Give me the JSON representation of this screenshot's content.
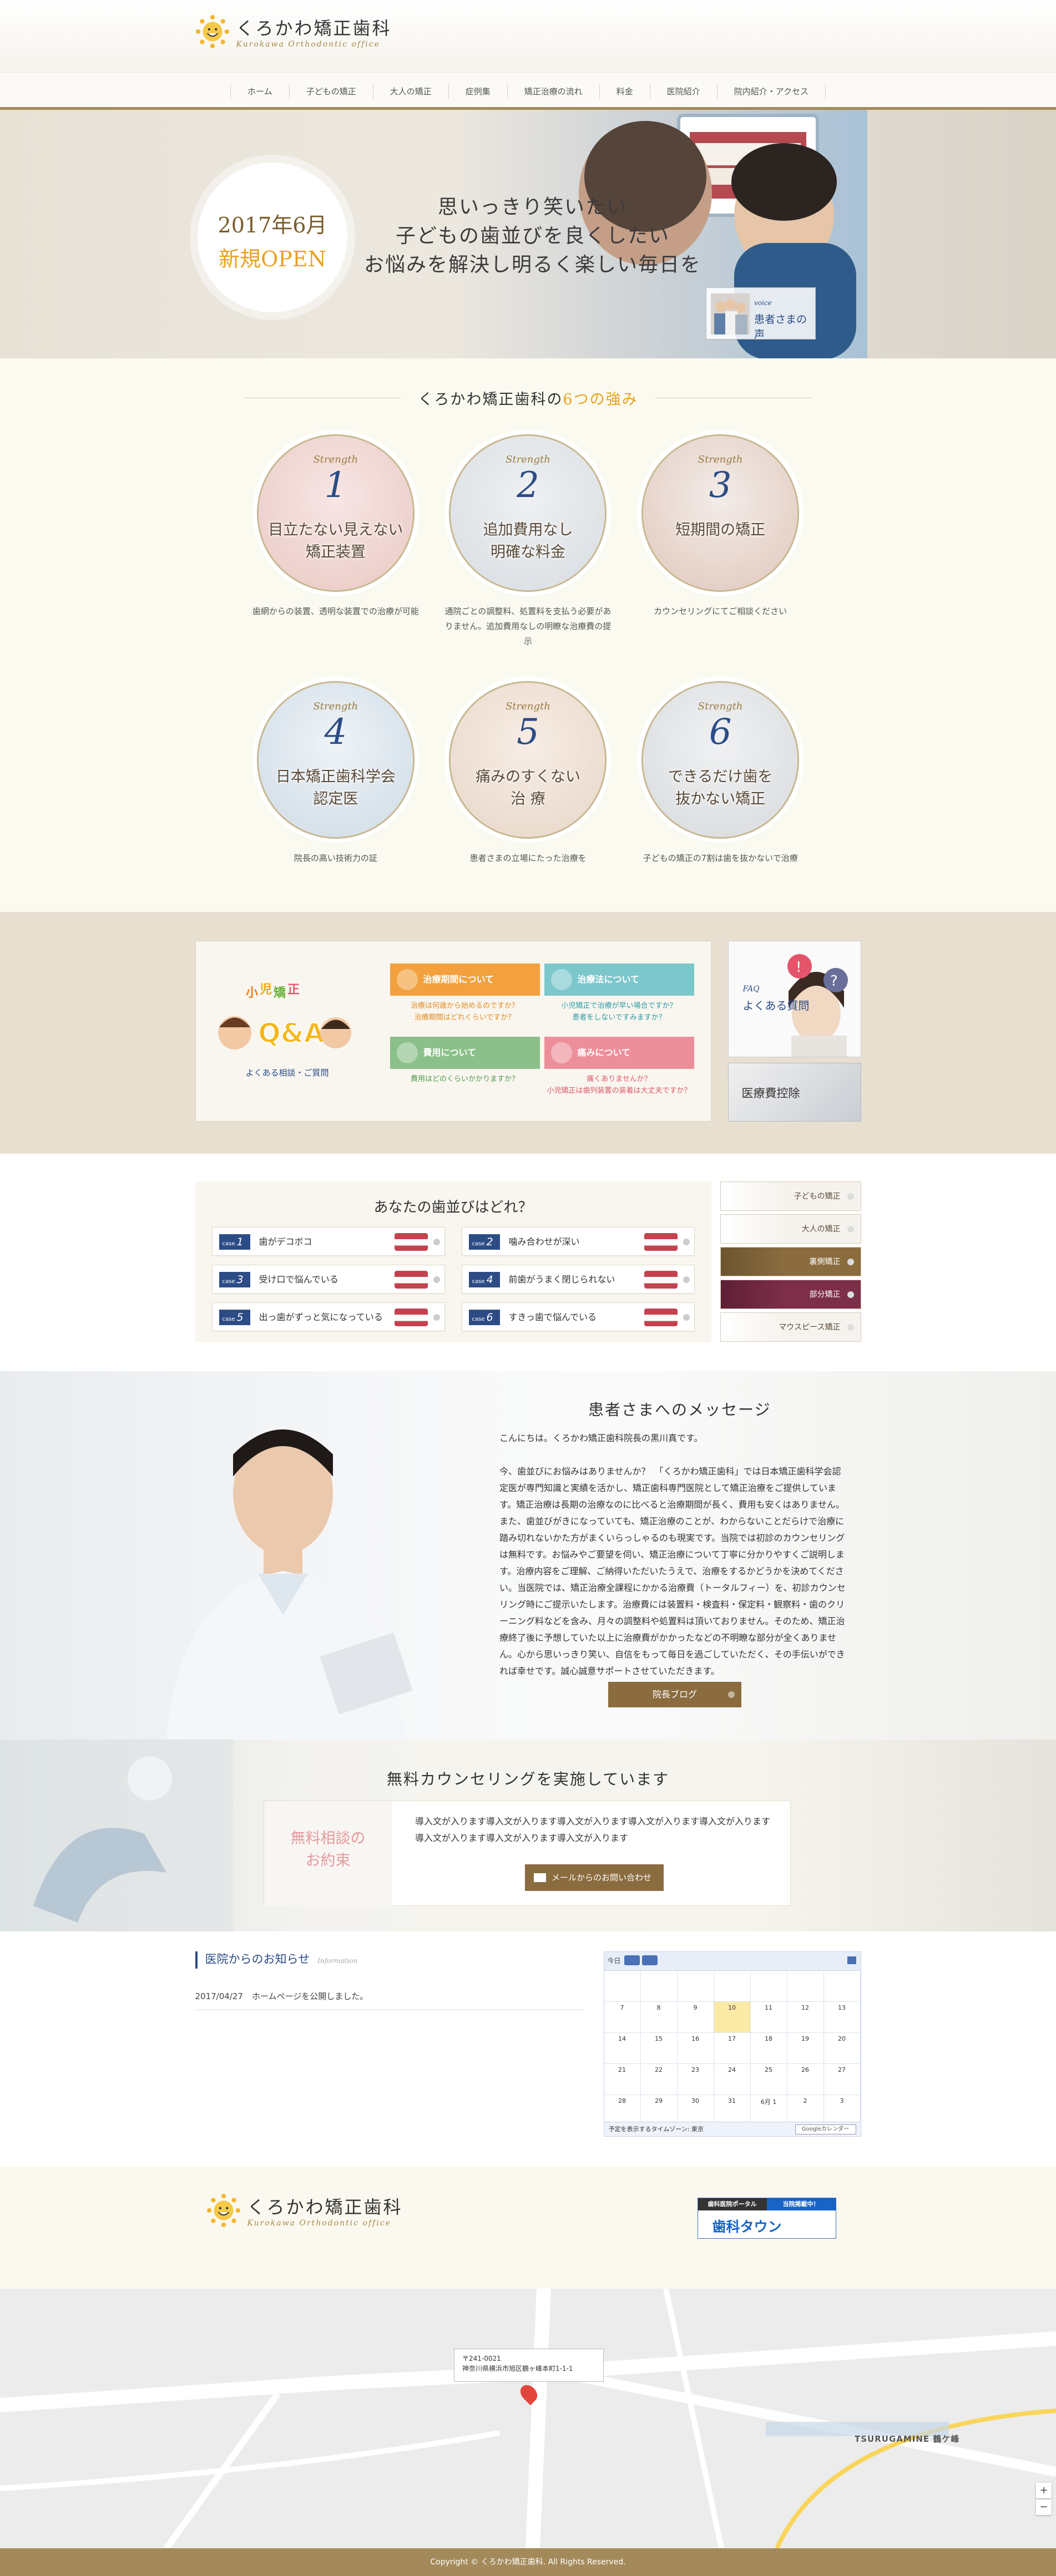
{
  "brand": {
    "name_jp": "くろかわ矯正歯科",
    "name_en": "Kurokawa Orthodontic office"
  },
  "nav": [
    "ホーム",
    "子どもの矯正",
    "大人の矯正",
    "症例集",
    "矯正治療の流れ",
    "料金",
    "医院紹介",
    "院内紹介・アクセス"
  ],
  "hero": {
    "open_line1": "2017年6月",
    "open_line2": "新規OPEN",
    "copy": [
      "思いっきり笑いたい",
      "子どもの歯並びを良くしたい",
      "お悩みを解決し明るく楽しい毎日を"
    ],
    "voice_en": "voice",
    "voice_jp": "患者さまの声"
  },
  "strengths": {
    "title_prefix": "くろかわ矯正歯科の",
    "title_highlight": "6つの強み",
    "items": [
      {
        "tag": "Strength",
        "num": "1",
        "title": "目立たない見えない\n矯正装置",
        "desc": "歯網からの装置、透明な装置での治療が可能"
      },
      {
        "tag": "Strength",
        "num": "2",
        "title": "追加費用なし\n明確な料金",
        "desc": "通院ごとの調整料、処置料を支払う必要がありません。追加費用なしの明瞭な治療費の提示"
      },
      {
        "tag": "Strength",
        "num": "3",
        "title": "短期間の矯正",
        "desc": "カウンセリングにてご相談ください"
      },
      {
        "tag": "Strength",
        "num": "4",
        "title": "日本矯正歯科学会\n認定医",
        "desc": "院長の高い技術力の証"
      },
      {
        "tag": "Strength",
        "num": "5",
        "title": "痛みのすくない\n治 療",
        "desc": "患者さまの立場にたった治療を"
      },
      {
        "tag": "Strength",
        "num": "6",
        "title": "できるだけ歯を\n抜かない矯正",
        "desc": "子どもの矯正の7割は歯を抜かないで治療"
      }
    ]
  },
  "qa": {
    "label": "よくある相談・ご質問",
    "buttons": [
      {
        "label": "治療期間について",
        "color": "#f2a13e",
        "links": [
          "治療は何歳から始めるのですか？",
          "治療期間はどれくらいですか？"
        ],
        "link_color": "#e68a1c"
      },
      {
        "label": "治療法について",
        "color": "#7cc7cc",
        "links": [
          "小児矯正で治療が早い場合ですか？",
          "患者をしないですみますか？"
        ],
        "link_color": "#2a9aa6"
      },
      {
        "label": "費用について",
        "color": "#8cc08a",
        "links": [
          "費用はどのくらいかかりますか？"
        ],
        "link_color": "#4f9a49"
      },
      {
        "label": "痛みについて",
        "color": "#ed8f9a",
        "links": [
          "痛くありませんか？",
          "小児矯正は歯列装置の装着は大丈夫ですか？"
        ],
        "link_color": "#e0576a"
      }
    ],
    "faq_en": "FAQ",
    "faq_jp": "よくある質問",
    "medical": "医療費控除"
  },
  "teeth": {
    "title": "あなたの歯並びはどれ？",
    "case_label": "case",
    "cases": [
      {
        "num": "1",
        "text": "歯がデコボコ"
      },
      {
        "num": "2",
        "text": "噛み合わせが深い"
      },
      {
        "num": "3",
        "text": "受け口で悩んでいる"
      },
      {
        "num": "4",
        "text": "前歯がうまく閉じられない"
      },
      {
        "num": "5",
        "text": "出っ歯がずっと気になっている"
      },
      {
        "num": "6",
        "text": "すきっ歯で悩んでいる"
      }
    ],
    "menu": [
      "子どもの矯正",
      "大人の矯正",
      "裏側矯正",
      "部分矯正",
      "マウスピース矯正"
    ]
  },
  "message": {
    "title": "患者さまへのメッセージ",
    "greeting": "こんにちは。くろかわ矯正歯科院長の黒川真です。",
    "body": "今、歯並びにお悩みはありませんか？　「くろかわ矯正歯科」では日本矯正歯科学会認定医が専門知識と実績を活かし、矯正歯科専門医院として矯正治療をご提供しています。矯正治療は長期の治療なのに比べると治療期間が長く、費用も安くはありません。また、歯並びがきになっていても、矯正治療のことが、わからないことだらけで治療に踏み切れないかた方がまくいらっしゃるのも現実です。当院では初診のカウンセリングは無料です。お悩みやご要望を伺い、矯正治療について丁寧に分かりやすくご説明します。治療内容をご理解、ご納得いただいたうえで、治療をするかどうかを決めてください。当医院では、矯正治療全課程にかかる治療費（トータルフィー）を、初診カウンセリング時にご提示いたします。治療費には装置料・検査料・保定料・観察料・歯のクリーニング料などを含み、月々の調整料や処置料は頂いておりません。そのため、矯正治療終了後に予想していた以上に治療費がかかったなどの不明瞭な部分が全くありません。心から思いっきり笑い、自信をもって毎日を過ごしていただく、その手伝いができれば幸せです。誠心誠意サポートさせていただきます。",
    "button": "院長ブログ"
  },
  "counsel": {
    "title": "無料カウンセリングを実施しています",
    "label": "無料相談の\nお約束",
    "text": "導入文が入ります導入文が入ります導入文が入ります導入文が入ります導入文が入ります導入文が入ります導入文が入ります導入文が入ります",
    "button": "メールからのお問い合わせ"
  },
  "news": {
    "title": "医院からのお知らせ",
    "subtitle": "Information",
    "items": [
      {
        "date": "2017/04/27",
        "text": "ホームページを公開しました。"
      }
    ]
  },
  "calendar": {
    "today_label": "今日",
    "weeks": [
      [
        "",
        "",
        "",
        "",
        "",
        "",
        ""
      ],
      [
        "7",
        "8",
        "9",
        "10",
        "11",
        "12",
        "13"
      ],
      [
        "14",
        "15",
        "16",
        "17",
        "18",
        "19",
        "20"
      ],
      [
        "21",
        "22",
        "23",
        "24",
        "25",
        "26",
        "27"
      ],
      [
        "28",
        "29",
        "30",
        "31",
        "6月 1",
        "2",
        "3"
      ]
    ],
    "highlight": "10",
    "footer": "予定を表示するタイムゾーン: 東京",
    "google_button": "Googleカレンダー"
  },
  "footer_banner": {
    "tag1": "歯科医院ポータル",
    "tag2": "当院掲載中！",
    "name": "歯科タウン"
  },
  "map": {
    "postal": "〒241-0021",
    "address": "神奈川県横浜市旭区鶴ヶ峰本町1-1-1",
    "district": "TSURUGAMINE 鶴ケ峰"
  },
  "copyright": "Copyright © くろかわ矯正歯科. All Rights Reserved."
}
